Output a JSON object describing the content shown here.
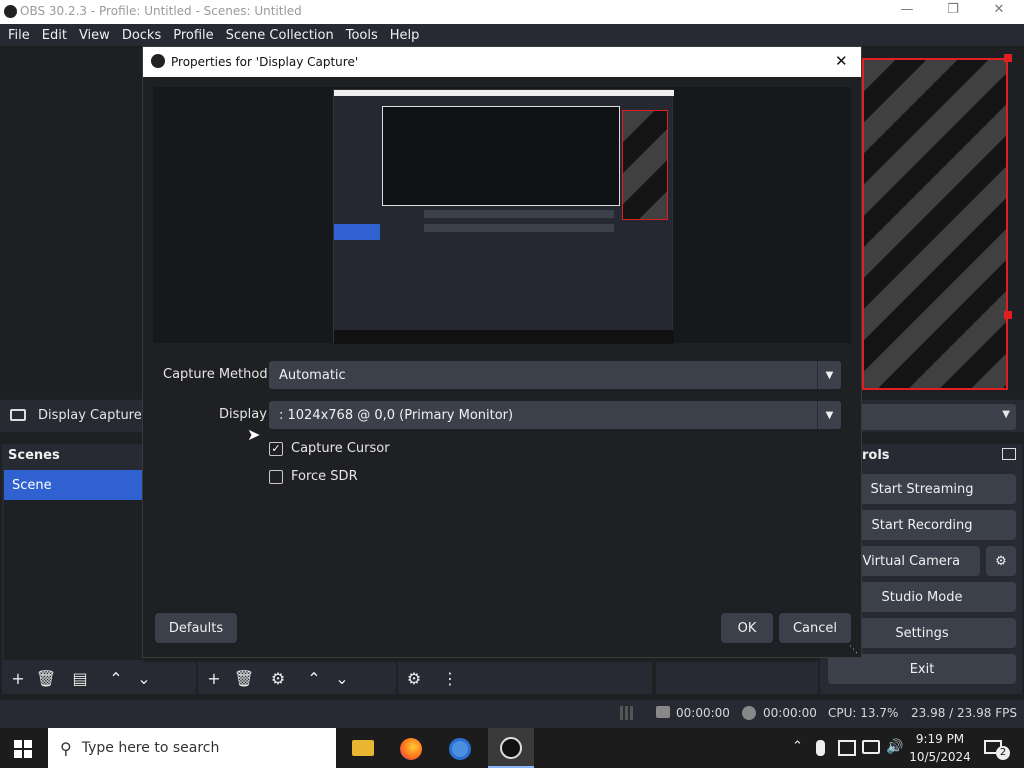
{
  "window": {
    "title": "OBS 30.2.3 - Profile: Untitled - Scenes: Untitled"
  },
  "menu": [
    "File",
    "Edit",
    "View",
    "Docks",
    "Profile",
    "Scene Collection",
    "Tools",
    "Help"
  ],
  "source_bar": {
    "label": "Display Capture"
  },
  "scenes": {
    "title": "Scenes",
    "items": [
      "Scene"
    ]
  },
  "controls": {
    "title_fragment": "rols",
    "buttons": {
      "stream": "Start Streaming",
      "record": "Start Recording",
      "virtual_cam": "rt Virtual Camera",
      "studio": "Studio Mode",
      "settings": "Settings",
      "exit": "Exit"
    }
  },
  "dialog": {
    "title": "Properties for 'Display Capture'",
    "capture_method_label": "Capture Method",
    "capture_method_value": "Automatic",
    "display_label": "Display",
    "display_value": ": 1024x768 @ 0,0 (Primary Monitor)",
    "capture_cursor_label": "Capture Cursor",
    "capture_cursor_checked": true,
    "force_sdr_label": "Force SDR",
    "force_sdr_checked": false,
    "defaults": "Defaults",
    "ok": "OK",
    "cancel": "Cancel"
  },
  "status": {
    "stream_time": "00:00:00",
    "rec_time": "00:00:00",
    "cpu": "CPU: 13.7%",
    "fps": "23.98 / 23.98 FPS"
  },
  "taskbar": {
    "search_placeholder": "Type here to search",
    "time": "9:19 PM",
    "date": "10/5/2024",
    "notifications": "2"
  }
}
